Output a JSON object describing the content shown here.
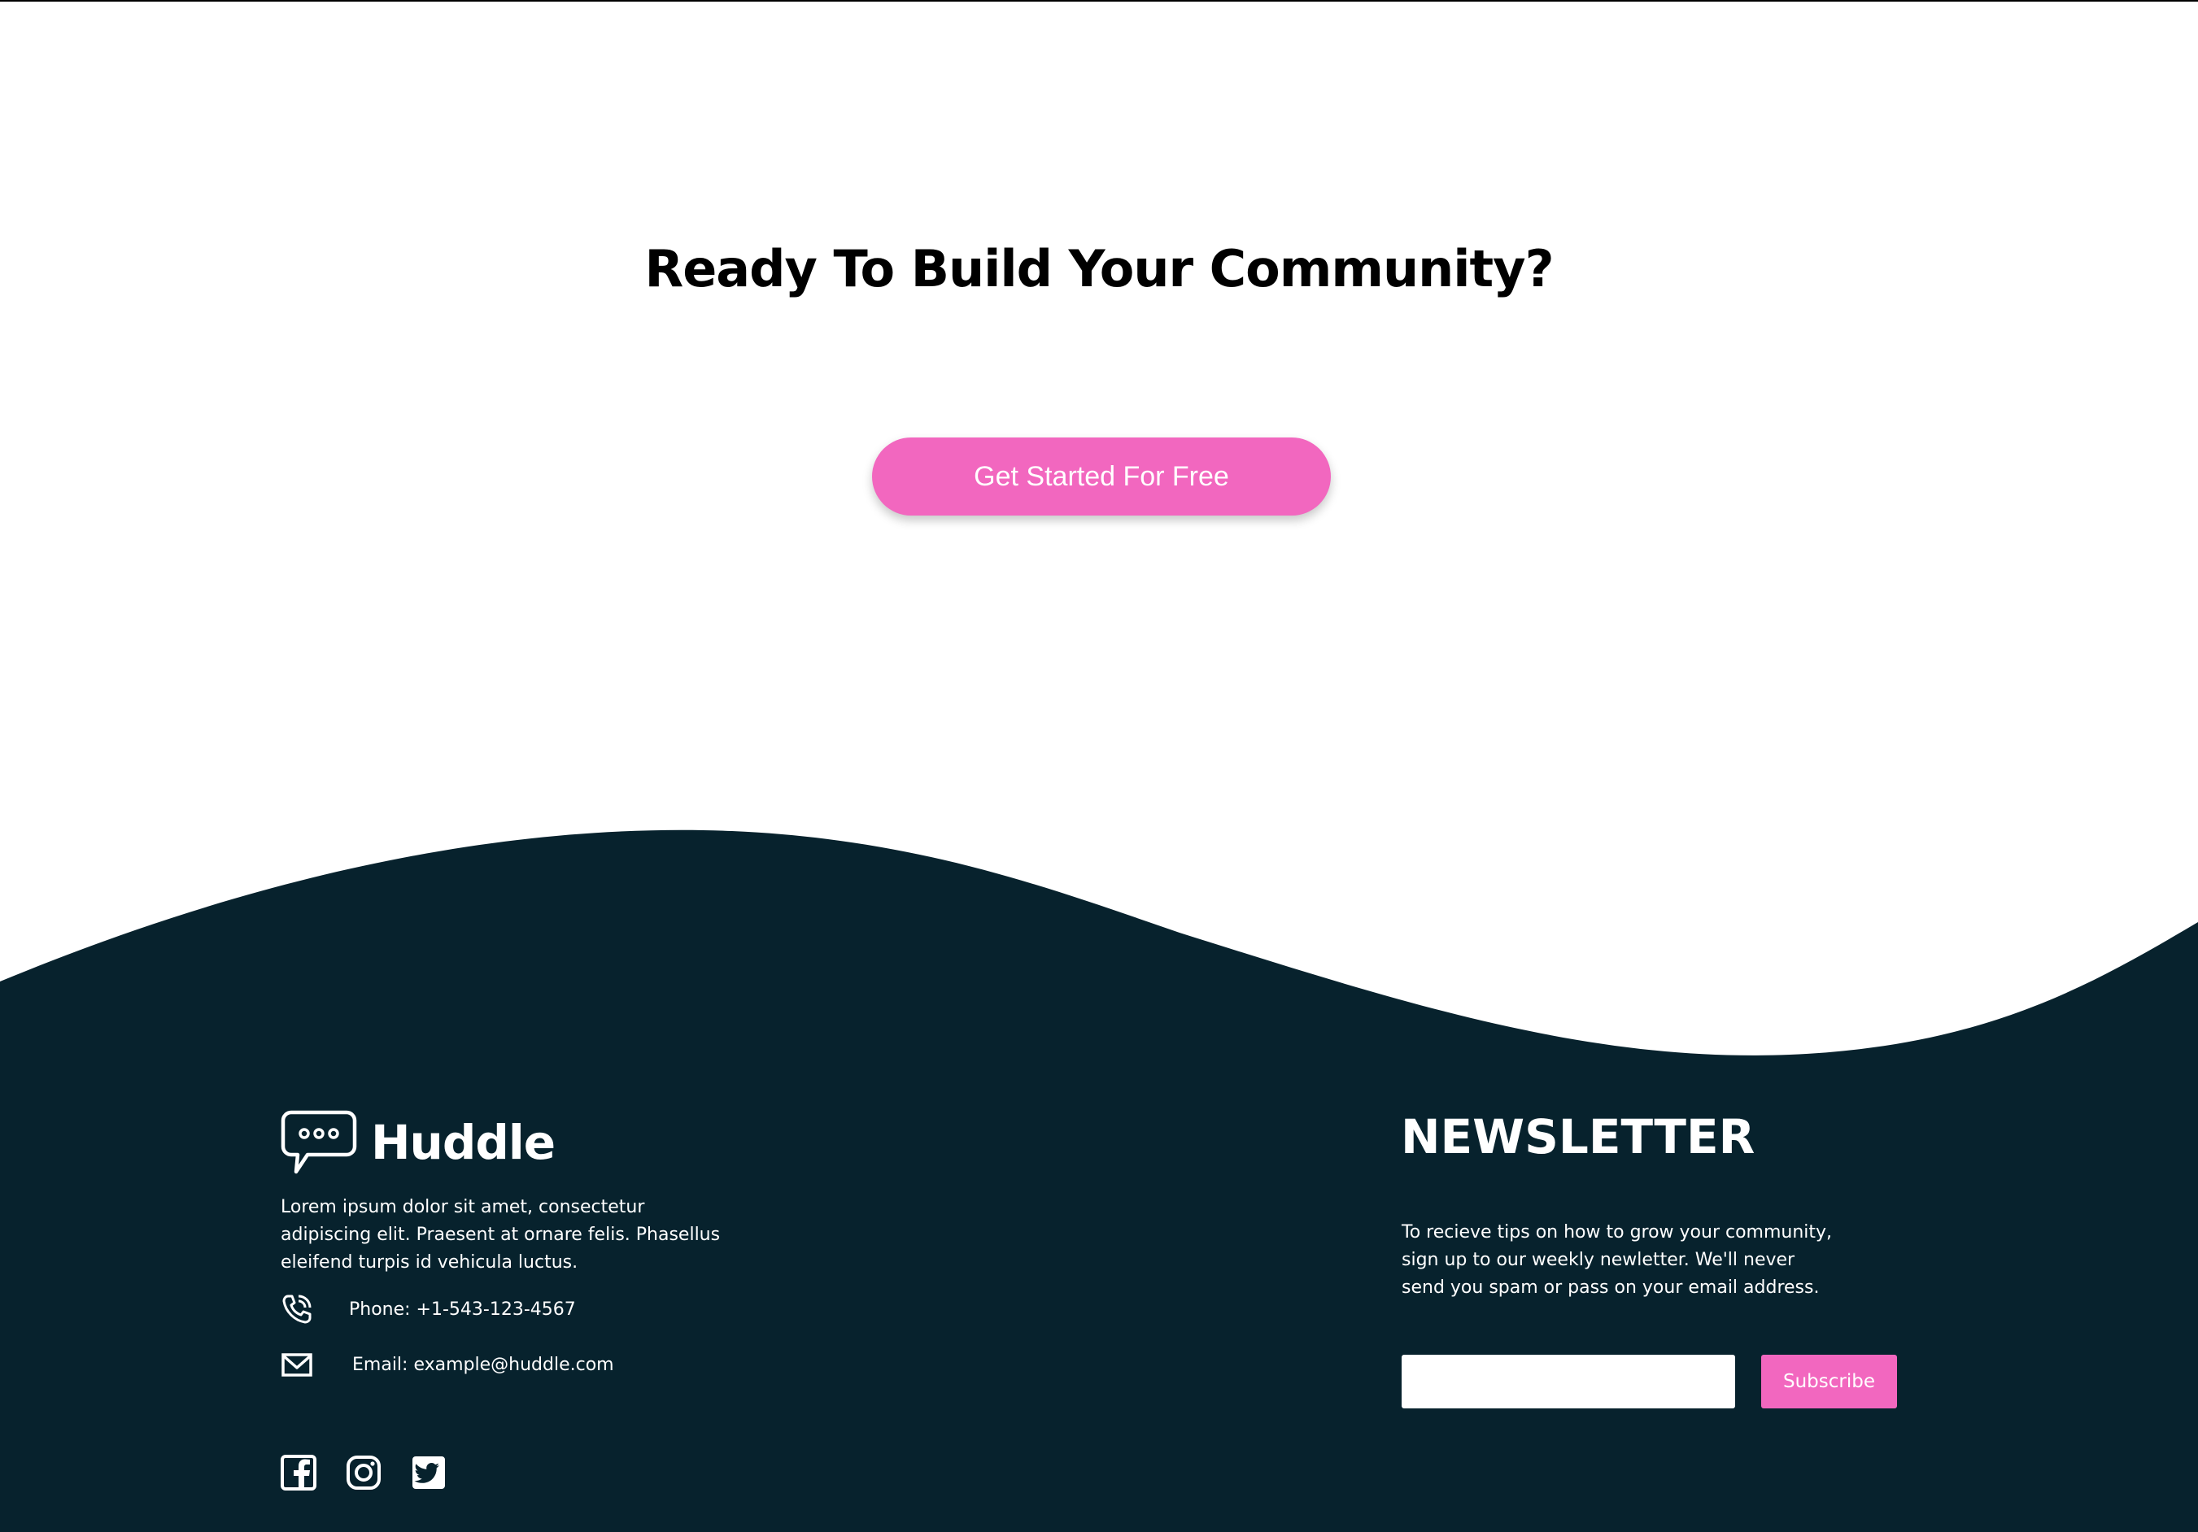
{
  "colors": {
    "accent": "#f267bf",
    "footer_bg": "#07222d",
    "text_dark": "#000000",
    "text_light": "#ffffff"
  },
  "cta": {
    "title": "Ready To Build Your Community?",
    "button_label": "Get Started For Free"
  },
  "footer": {
    "brand": {
      "name": "Huddle",
      "icon": "chat-bubble-icon"
    },
    "about": "Lorem ipsum dolor sit amet, consectetur adipiscing elit. Praesent at ornare felis. Phasellus eleifend turpis id vehicula luctus.",
    "contact": {
      "phone": {
        "icon": "phone-icon",
        "text": "Phone: +1-543-123-4567"
      },
      "email": {
        "icon": "mail-icon",
        "text": "Email: example@huddle.com"
      }
    },
    "socials": [
      {
        "icon": "facebook-icon"
      },
      {
        "icon": "instagram-icon"
      },
      {
        "icon": "twitter-icon"
      }
    ]
  },
  "newsletter": {
    "title": "NEWSLETTER",
    "description": "To recieve tips on how to grow your community, sign up to our weekly newletter. We'll never send you spam or pass on your email address.",
    "input_value": "",
    "subscribe_label": "Subscribe"
  }
}
